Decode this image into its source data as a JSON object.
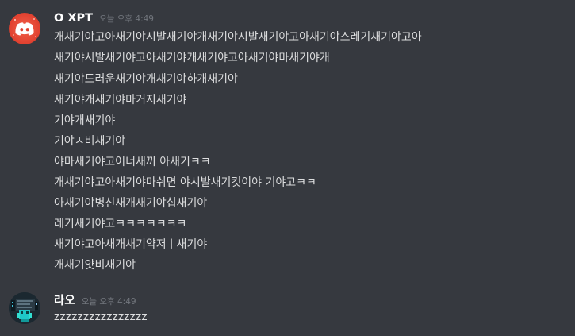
{
  "messages": [
    {
      "username": "O XPT",
      "timestamp": "오늘 오후 4:49",
      "avatar_icon": "discord-logo-icon",
      "lines": [
        "개새기야고아새기야시발새기야개새기야시발새기야고아새기야스레기새기야고아",
        "새기야시발새기야고아새기야개새기야고아새기야마새기야개",
        "새기야드러운새기야개새기야하개새기야",
        "새기야개새기야마거지새기야",
        "기야개새기야",
        "기야ㅅ비새기야",
        "야마새기야고어너새끼 아새기ㅋㅋ",
        "개새기야고아새기야마쉬면 야시발새기컷이야 기야고ㅋㅋ",
        "아새기야병신새개새기야십새기야",
        "레기새기야고ㅋㅋㅋㅋㅋㅋㅋ",
        "새기야고아새개새기약저ㅣ새기야",
        "개새기얏비새기야"
      ]
    },
    {
      "username": "라오",
      "timestamp": "오늘 오후 4:49",
      "avatar_icon": "pixel-art-avatar-icon",
      "lines": [
        "zzzzzzzzzzzzzzzz"
      ]
    }
  ],
  "colors": {
    "background": "#36393f",
    "username": "#ffffff",
    "timestamp": "#72767d",
    "message_text": "#dcddde",
    "avatar_red": "#e74c3c"
  }
}
